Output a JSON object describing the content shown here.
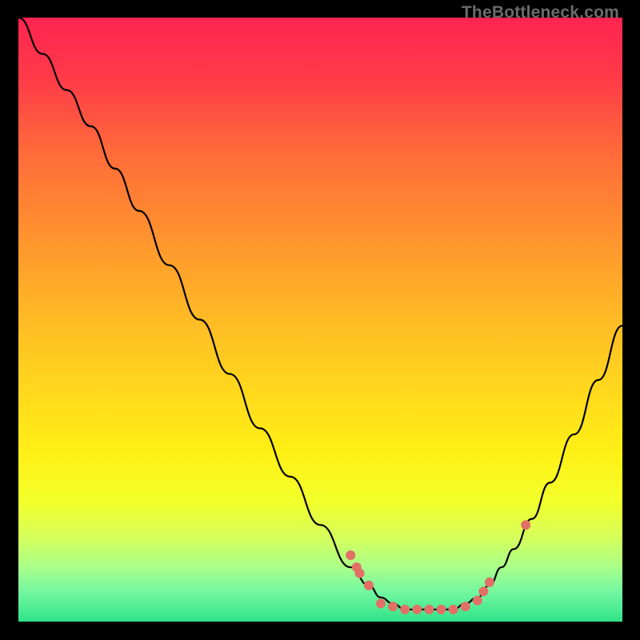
{
  "watermark": "TheBottleneck.com",
  "chart_data": {
    "type": "line",
    "title": "",
    "xlabel": "",
    "ylabel": "",
    "xlim": [
      0,
      100
    ],
    "ylim": [
      0,
      100
    ],
    "grid": false,
    "background_gradient": {
      "stops": [
        {
          "offset": 0.0,
          "color": "#ff2450"
        },
        {
          "offset": 0.1,
          "color": "#ff3a49"
        },
        {
          "offset": 0.22,
          "color": "#ff6a3a"
        },
        {
          "offset": 0.35,
          "color": "#ff8f2f"
        },
        {
          "offset": 0.48,
          "color": "#ffb526"
        },
        {
          "offset": 0.6,
          "color": "#ffd41e"
        },
        {
          "offset": 0.72,
          "color": "#fff016"
        },
        {
          "offset": 0.8,
          "color": "#f3ff2a"
        },
        {
          "offset": 0.86,
          "color": "#d6ff5a"
        },
        {
          "offset": 0.91,
          "color": "#a9ff8a"
        },
        {
          "offset": 0.95,
          "color": "#74f7a0"
        },
        {
          "offset": 1.0,
          "color": "#30e38a"
        }
      ]
    },
    "series": [
      {
        "name": "bottleneck-curve",
        "x": [
          0,
          4,
          8,
          12,
          16,
          20,
          25,
          30,
          35,
          40,
          45,
          50,
          55,
          58,
          60,
          62,
          64,
          66,
          68,
          70,
          72,
          74,
          76,
          78,
          80,
          82,
          85,
          88,
          92,
          96,
          100
        ],
        "y": [
          100,
          94,
          88,
          82,
          75,
          68,
          59,
          50,
          41,
          32,
          24,
          16,
          9,
          6,
          4,
          3,
          2,
          2,
          2,
          2,
          2,
          3,
          4,
          6,
          9,
          12,
          17,
          23,
          31,
          40,
          49
        ]
      }
    ],
    "scatter": {
      "name": "marked-points",
      "x": [
        55,
        56,
        56.5,
        58,
        60,
        62,
        64,
        66,
        68,
        70,
        72,
        74,
        76,
        77,
        78,
        84
      ],
      "y": [
        11,
        9,
        8,
        6,
        3,
        2.5,
        2,
        2,
        2,
        2,
        2,
        2.5,
        3.5,
        5,
        6.5,
        16
      ],
      "color": "#e27066",
      "radius": 6
    }
  }
}
